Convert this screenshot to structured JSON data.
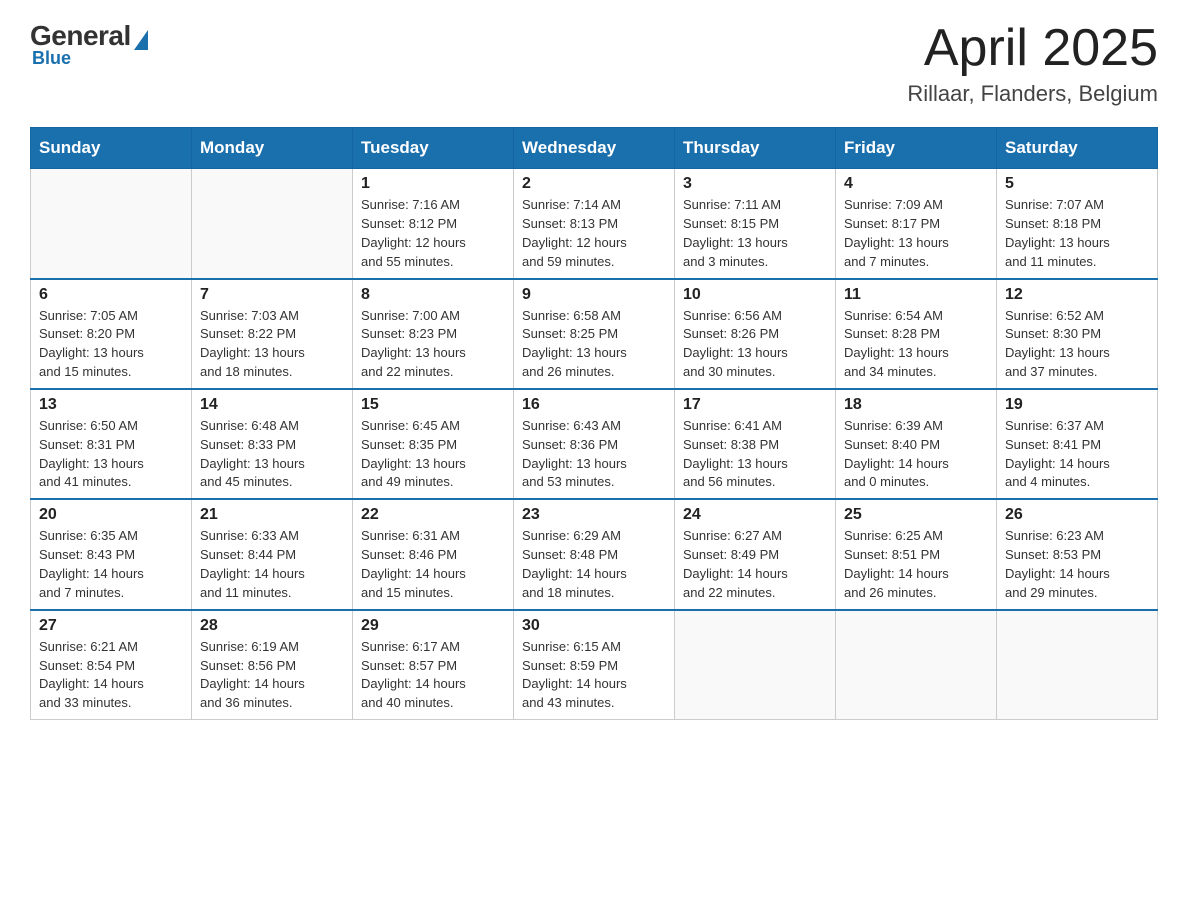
{
  "header": {
    "logo_general": "General",
    "logo_blue": "Blue",
    "month_year": "April 2025",
    "location": "Rillaar, Flanders, Belgium"
  },
  "weekdays": [
    "Sunday",
    "Monday",
    "Tuesday",
    "Wednesday",
    "Thursday",
    "Friday",
    "Saturday"
  ],
  "weeks": [
    [
      {
        "day": "",
        "info": ""
      },
      {
        "day": "",
        "info": ""
      },
      {
        "day": "1",
        "info": "Sunrise: 7:16 AM\nSunset: 8:12 PM\nDaylight: 12 hours\nand 55 minutes."
      },
      {
        "day": "2",
        "info": "Sunrise: 7:14 AM\nSunset: 8:13 PM\nDaylight: 12 hours\nand 59 minutes."
      },
      {
        "day": "3",
        "info": "Sunrise: 7:11 AM\nSunset: 8:15 PM\nDaylight: 13 hours\nand 3 minutes."
      },
      {
        "day": "4",
        "info": "Sunrise: 7:09 AM\nSunset: 8:17 PM\nDaylight: 13 hours\nand 7 minutes."
      },
      {
        "day": "5",
        "info": "Sunrise: 7:07 AM\nSunset: 8:18 PM\nDaylight: 13 hours\nand 11 minutes."
      }
    ],
    [
      {
        "day": "6",
        "info": "Sunrise: 7:05 AM\nSunset: 8:20 PM\nDaylight: 13 hours\nand 15 minutes."
      },
      {
        "day": "7",
        "info": "Sunrise: 7:03 AM\nSunset: 8:22 PM\nDaylight: 13 hours\nand 18 minutes."
      },
      {
        "day": "8",
        "info": "Sunrise: 7:00 AM\nSunset: 8:23 PM\nDaylight: 13 hours\nand 22 minutes."
      },
      {
        "day": "9",
        "info": "Sunrise: 6:58 AM\nSunset: 8:25 PM\nDaylight: 13 hours\nand 26 minutes."
      },
      {
        "day": "10",
        "info": "Sunrise: 6:56 AM\nSunset: 8:26 PM\nDaylight: 13 hours\nand 30 minutes."
      },
      {
        "day": "11",
        "info": "Sunrise: 6:54 AM\nSunset: 8:28 PM\nDaylight: 13 hours\nand 34 minutes."
      },
      {
        "day": "12",
        "info": "Sunrise: 6:52 AM\nSunset: 8:30 PM\nDaylight: 13 hours\nand 37 minutes."
      }
    ],
    [
      {
        "day": "13",
        "info": "Sunrise: 6:50 AM\nSunset: 8:31 PM\nDaylight: 13 hours\nand 41 minutes."
      },
      {
        "day": "14",
        "info": "Sunrise: 6:48 AM\nSunset: 8:33 PM\nDaylight: 13 hours\nand 45 minutes."
      },
      {
        "day": "15",
        "info": "Sunrise: 6:45 AM\nSunset: 8:35 PM\nDaylight: 13 hours\nand 49 minutes."
      },
      {
        "day": "16",
        "info": "Sunrise: 6:43 AM\nSunset: 8:36 PM\nDaylight: 13 hours\nand 53 minutes."
      },
      {
        "day": "17",
        "info": "Sunrise: 6:41 AM\nSunset: 8:38 PM\nDaylight: 13 hours\nand 56 minutes."
      },
      {
        "day": "18",
        "info": "Sunrise: 6:39 AM\nSunset: 8:40 PM\nDaylight: 14 hours\nand 0 minutes."
      },
      {
        "day": "19",
        "info": "Sunrise: 6:37 AM\nSunset: 8:41 PM\nDaylight: 14 hours\nand 4 minutes."
      }
    ],
    [
      {
        "day": "20",
        "info": "Sunrise: 6:35 AM\nSunset: 8:43 PM\nDaylight: 14 hours\nand 7 minutes."
      },
      {
        "day": "21",
        "info": "Sunrise: 6:33 AM\nSunset: 8:44 PM\nDaylight: 14 hours\nand 11 minutes."
      },
      {
        "day": "22",
        "info": "Sunrise: 6:31 AM\nSunset: 8:46 PM\nDaylight: 14 hours\nand 15 minutes."
      },
      {
        "day": "23",
        "info": "Sunrise: 6:29 AM\nSunset: 8:48 PM\nDaylight: 14 hours\nand 18 minutes."
      },
      {
        "day": "24",
        "info": "Sunrise: 6:27 AM\nSunset: 8:49 PM\nDaylight: 14 hours\nand 22 minutes."
      },
      {
        "day": "25",
        "info": "Sunrise: 6:25 AM\nSunset: 8:51 PM\nDaylight: 14 hours\nand 26 minutes."
      },
      {
        "day": "26",
        "info": "Sunrise: 6:23 AM\nSunset: 8:53 PM\nDaylight: 14 hours\nand 29 minutes."
      }
    ],
    [
      {
        "day": "27",
        "info": "Sunrise: 6:21 AM\nSunset: 8:54 PM\nDaylight: 14 hours\nand 33 minutes."
      },
      {
        "day": "28",
        "info": "Sunrise: 6:19 AM\nSunset: 8:56 PM\nDaylight: 14 hours\nand 36 minutes."
      },
      {
        "day": "29",
        "info": "Sunrise: 6:17 AM\nSunset: 8:57 PM\nDaylight: 14 hours\nand 40 minutes."
      },
      {
        "day": "30",
        "info": "Sunrise: 6:15 AM\nSunset: 8:59 PM\nDaylight: 14 hours\nand 43 minutes."
      },
      {
        "day": "",
        "info": ""
      },
      {
        "day": "",
        "info": ""
      },
      {
        "day": "",
        "info": ""
      }
    ]
  ]
}
